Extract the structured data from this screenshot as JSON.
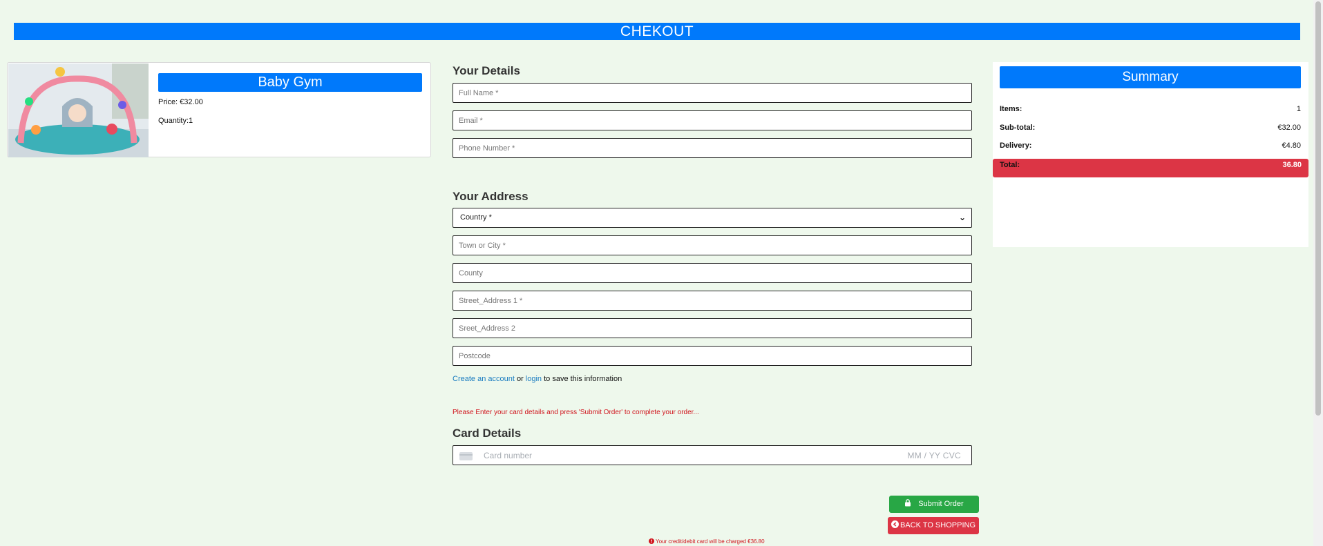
{
  "header": {
    "title": "CHEKOUT"
  },
  "product": {
    "name": "Baby Gym",
    "price": "Price: €32.00",
    "quantity": "Quantity:1"
  },
  "details": {
    "heading": "Your Details",
    "full_name_placeholder": "Full Name *",
    "email_placeholder": "Email *",
    "phone_placeholder": "Phone Number *"
  },
  "address": {
    "heading": "Your Address",
    "country_selected": "Country *",
    "town_placeholder": "Town or City *",
    "county_placeholder": "County",
    "street1_placeholder": "Street_Address 1 *",
    "street2_placeholder": "Sreet_Address 2",
    "postcode_placeholder": "Postcode"
  },
  "account_prompt": {
    "create_link": "Create an account",
    "or": "or",
    "login_link": "login",
    "suffix": "to save this information"
  },
  "card": {
    "notice": "Please Enter your card details and press 'Submit Order' to complete your order...",
    "heading": "Card Details",
    "number_placeholder": "Card number",
    "exp_cvc_placeholder": "MM / YY  CVC"
  },
  "actions": {
    "submit_label": "Submit Order",
    "back_label": "BACK TO SHOPPING",
    "charge_note": "Your credit/debit card will be charged €36.80"
  },
  "summary": {
    "title": "Summary",
    "items_label": "Items:",
    "items_value": "1",
    "subtotal_label": "Sub-total:",
    "subtotal_value": "€32.00",
    "delivery_label": "Delivery:",
    "delivery_value": "€4.80",
    "total_label": "Total:",
    "total_value": "36.80"
  },
  "colors": {
    "page_bg": "#eef8ec",
    "primary": "#0079fb",
    "success": "#28a745",
    "danger": "#dc3545",
    "link": "#1a7cc0"
  },
  "icons": [
    "lock-icon",
    "arrow-left-circle-icon",
    "alert-circle-icon",
    "card-brand-icon",
    "chevron-down-icon"
  ]
}
